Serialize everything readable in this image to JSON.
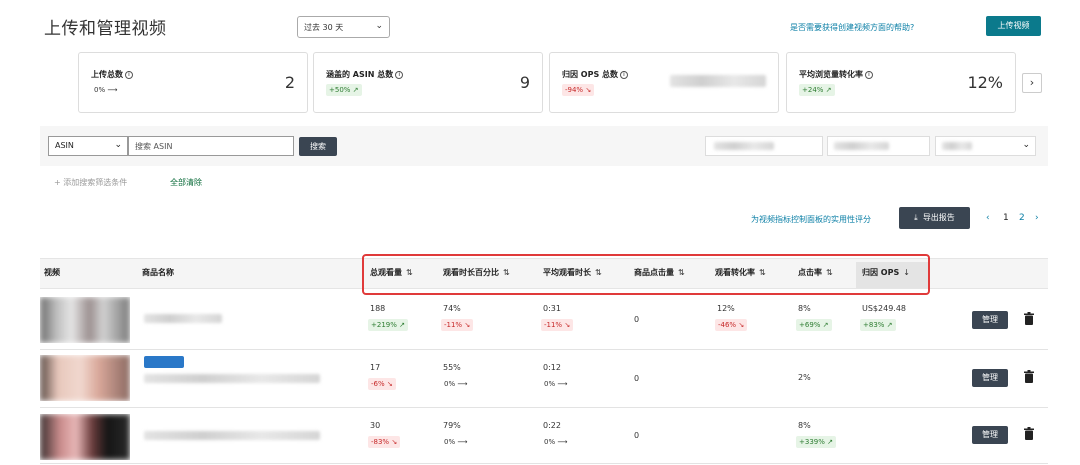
{
  "header": {
    "title": "上传和管理视频",
    "range_label": "过去 30 天",
    "help_link": "是否需要获得创建视频方面的帮助?",
    "upload_button": "上传视频"
  },
  "stats": [
    {
      "label": "上传总数",
      "value": "2",
      "trend": "0%",
      "trend_dir": "flat"
    },
    {
      "label": "涵盖的 ASIN 总数",
      "value": "9",
      "trend": "+50%",
      "trend_dir": "up"
    },
    {
      "label": "归因 OPS 总数",
      "value": "",
      "trend": "-94%",
      "trend_dir": "down"
    },
    {
      "label": "平均浏览量转化率",
      "value": "12%",
      "trend": "+24%",
      "trend_dir": "up"
    }
  ],
  "filters": {
    "asin_select": "ASIN",
    "search_placeholder": "搜索 ASIN",
    "search_button": "搜索",
    "add_filter": "+ 添加搜索筛选条件",
    "clear_all": "全部清除"
  },
  "toolbar": {
    "rating_link": "为视频指标控制面板的实用性评分",
    "export_button": "导出报告",
    "pages": [
      "1",
      "2"
    ]
  },
  "table": {
    "columns": [
      "视频",
      "商品名称",
      "总观看量",
      "观看时长百分比",
      "平均观看时长",
      "商品点击量",
      "观看转化率",
      "点击率",
      "归因 OPS"
    ],
    "rows": [
      {
        "views": "188",
        "views_trend": "+219%",
        "views_dir": "up",
        "watch_pct": "74%",
        "watch_pct_trend": "-11%",
        "watch_pct_dir": "down",
        "avg_time": "0:31",
        "avg_time_trend": "-11%",
        "avg_time_dir": "down",
        "clicks": "0",
        "conv": "12%",
        "conv_trend": "-46%",
        "conv_dir": "down",
        "ctr": "8%",
        "ctr_trend": "+69%",
        "ctr_dir": "up",
        "ops": "US$249.48",
        "ops_trend": "+83%",
        "ops_dir": "up",
        "manage": "管理"
      },
      {
        "views": "17",
        "views_trend": "-6%",
        "views_dir": "down",
        "watch_pct": "55%",
        "watch_pct_trend": "0%",
        "watch_pct_dir": "flat",
        "avg_time": "0:12",
        "avg_time_trend": "0%",
        "avg_time_dir": "flat",
        "clicks": "0",
        "conv": "",
        "conv_trend": "",
        "conv_dir": "",
        "ctr": "2%",
        "ctr_trend": "",
        "ctr_dir": "",
        "ops": "",
        "ops_trend": "",
        "ops_dir": "",
        "manage": "管理"
      },
      {
        "views": "30",
        "views_trend": "-83%",
        "views_dir": "down",
        "watch_pct": "79%",
        "watch_pct_trend": "0%",
        "watch_pct_dir": "flat",
        "avg_time": "0:22",
        "avg_time_trend": "0%",
        "avg_time_dir": "flat",
        "clicks": "0",
        "conv": "",
        "conv_trend": "",
        "conv_dir": "",
        "ctr": "8%",
        "ctr_trend": "+339%",
        "ctr_dir": "up",
        "ops": "",
        "ops_trend": "",
        "ops_dir": "",
        "manage": "管理"
      }
    ]
  },
  "colors": {
    "accent": "#0b7a8c",
    "dark_button": "#3a4552",
    "link": "#0b7fa6",
    "highlight": "#e03a3a",
    "up": "#2e7d32",
    "down": "#c62828"
  }
}
